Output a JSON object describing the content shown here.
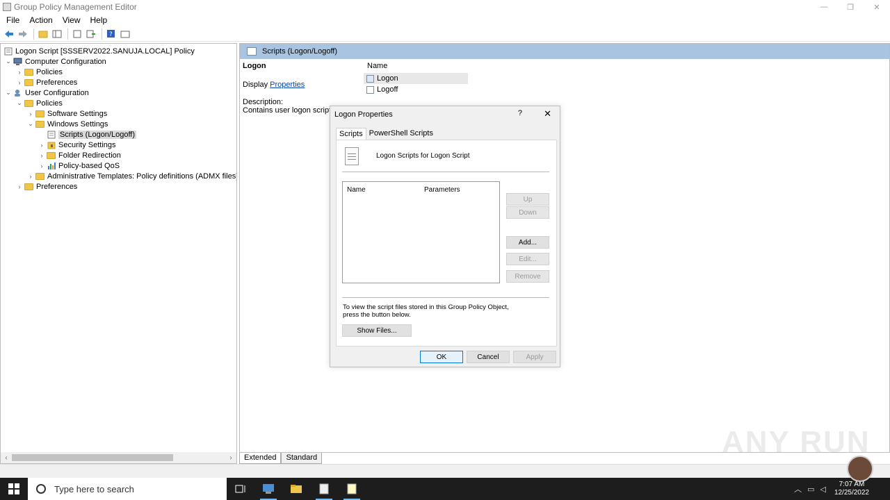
{
  "window": {
    "title": "Group Policy Management Editor",
    "minimize": "—",
    "maximize": "❐",
    "close": "✕"
  },
  "menu": [
    "File",
    "Action",
    "View",
    "Help"
  ],
  "tree": {
    "root": "Logon Script [SSSERV2022.SANUJA.LOCAL] Policy",
    "computer_config": "Computer Configuration",
    "cc_policies": "Policies",
    "cc_preferences": "Preferences",
    "user_config": "User Configuration",
    "uc_policies": "Policies",
    "software_settings": "Software Settings",
    "windows_settings": "Windows Settings",
    "scripts": "Scripts (Logon/Logoff)",
    "security_settings": "Security Settings",
    "folder_redirection": "Folder Redirection",
    "qos": "Policy-based QoS",
    "admin_templates": "Administrative Templates: Policy definitions (ADMX files) retrieved",
    "uc_preferences": "Preferences"
  },
  "right_pane": {
    "header": "Scripts (Logon/Logoff)",
    "selected_name": "Logon",
    "display_prefix": "Display",
    "display_link": "Properties",
    "description_label": "Description:",
    "description_text": "Contains user logon scripts.",
    "list_header": "Name",
    "items": [
      "Logon",
      "Logoff"
    ]
  },
  "bottom_tabs": {
    "extended": "Extended",
    "standard": "Standard"
  },
  "dialog": {
    "title": "Logon Properties",
    "help": "?",
    "close": "✕",
    "tabs": [
      "Scripts",
      "PowerShell Scripts"
    ],
    "panel_title": "Logon Scripts for Logon Script",
    "col_name": "Name",
    "col_params": "Parameters",
    "btn_up": "Up",
    "btn_down": "Down",
    "btn_add": "Add...",
    "btn_edit": "Edit...",
    "btn_remove": "Remove",
    "info": "To view the script files stored in this Group Policy Object, press the button below.",
    "show_files": "Show Files...",
    "ok": "OK",
    "cancel": "Cancel",
    "apply": "Apply"
  },
  "taskbar": {
    "search_placeholder": "Type here to search",
    "time": "7:07 AM",
    "date": "12/25/2022"
  },
  "watermark": "ANY RUN"
}
